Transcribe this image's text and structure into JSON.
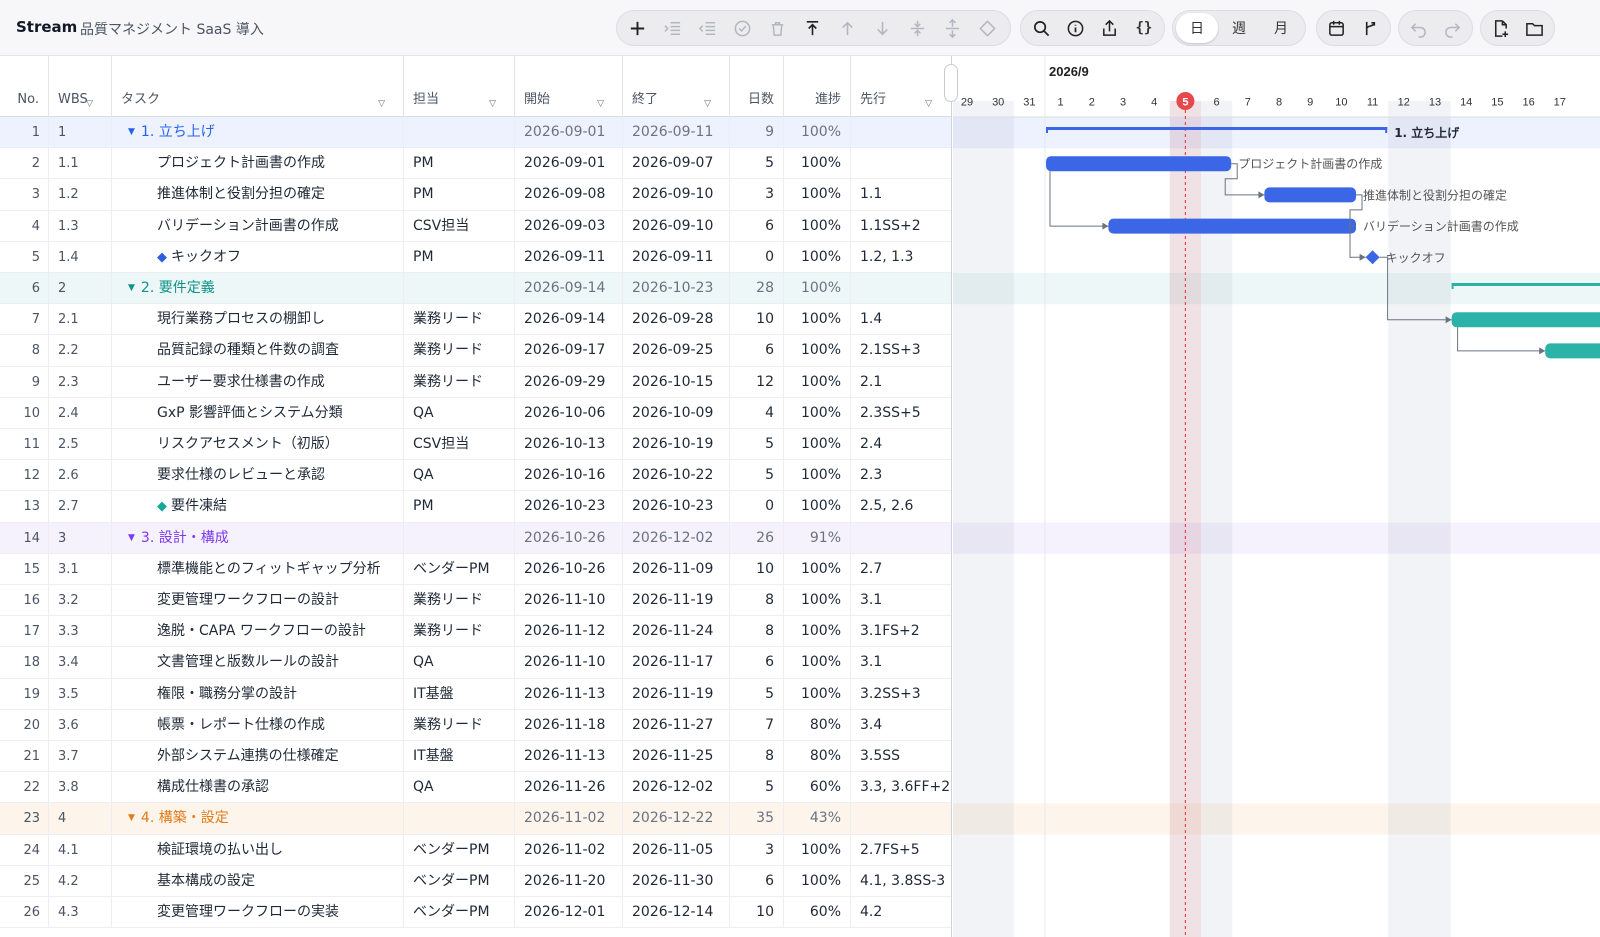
{
  "app": {
    "name": "Stream",
    "project": "品質マネジメント SaaS 導入"
  },
  "toolbar": {
    "views": [
      "日",
      "週",
      "月"
    ],
    "active_view": "日",
    "braces_label": "{}"
  },
  "columns": {
    "no": "No.",
    "wbs": "WBS",
    "task": "タスク",
    "owner": "担当",
    "start": "開始",
    "end": "終了",
    "days": "日数",
    "progress": "進捗",
    "pred": "先行"
  },
  "rows": [
    {
      "no": "1",
      "wbs": "1",
      "task": "1. 立ち上げ",
      "owner": "",
      "start": "2026-09-01",
      "end": "2026-09-11",
      "days": "9",
      "progress": "100%",
      "pred": "",
      "group": 1,
      "milestone": false
    },
    {
      "no": "2",
      "wbs": "1.1",
      "task": "プロジェクト計画書の作成",
      "owner": "PM",
      "start": "2026-09-01",
      "end": "2026-09-07",
      "days": "5",
      "progress": "100%",
      "pred": "",
      "group": 0,
      "milestone": false
    },
    {
      "no": "3",
      "wbs": "1.2",
      "task": "推進体制と役割分担の確定",
      "owner": "PM",
      "start": "2026-09-08",
      "end": "2026-09-10",
      "days": "3",
      "progress": "100%",
      "pred": "1.1",
      "group": 0,
      "milestone": false
    },
    {
      "no": "4",
      "wbs": "1.3",
      "task": "バリデーション計画書の作成",
      "owner": "CSV担当",
      "start": "2026-09-03",
      "end": "2026-09-10",
      "days": "6",
      "progress": "100%",
      "pred": "1.1SS+2",
      "group": 0,
      "milestone": false
    },
    {
      "no": "5",
      "wbs": "1.4",
      "task": "キックオフ",
      "owner": "PM",
      "start": "2026-09-11",
      "end": "2026-09-11",
      "days": "0",
      "progress": "100%",
      "pred": "1.2, 1.3",
      "group": 0,
      "milestone": true,
      "ms_color": "#2f5fe0"
    },
    {
      "no": "6",
      "wbs": "2",
      "task": "2. 要件定義",
      "owner": "",
      "start": "2026-09-14",
      "end": "2026-10-23",
      "days": "28",
      "progress": "100%",
      "pred": "",
      "group": 2,
      "milestone": false
    },
    {
      "no": "7",
      "wbs": "2.1",
      "task": "現行業務プロセスの棚卸し",
      "owner": "業務リード",
      "start": "2026-09-14",
      "end": "2026-09-28",
      "days": "10",
      "progress": "100%",
      "pred": "1.4",
      "group": 0,
      "milestone": false
    },
    {
      "no": "8",
      "wbs": "2.2",
      "task": "品質記録の種類と件数の調査",
      "owner": "業務リード",
      "start": "2026-09-17",
      "end": "2026-09-25",
      "days": "6",
      "progress": "100%",
      "pred": "2.1SS+3",
      "group": 0,
      "milestone": false
    },
    {
      "no": "9",
      "wbs": "2.3",
      "task": "ユーザー要求仕様書の作成",
      "owner": "業務リード",
      "start": "2026-09-29",
      "end": "2026-10-15",
      "days": "12",
      "progress": "100%",
      "pred": "2.1",
      "group": 0,
      "milestone": false
    },
    {
      "no": "10",
      "wbs": "2.4",
      "task": "GxP 影響評価とシステム分類",
      "owner": "QA",
      "start": "2026-10-06",
      "end": "2026-10-09",
      "days": "4",
      "progress": "100%",
      "pred": "2.3SS+5",
      "group": 0,
      "milestone": false
    },
    {
      "no": "11",
      "wbs": "2.5",
      "task": "リスクアセスメント（初版）",
      "owner": "CSV担当",
      "start": "2026-10-13",
      "end": "2026-10-19",
      "days": "5",
      "progress": "100%",
      "pred": "2.4",
      "group": 0,
      "milestone": false
    },
    {
      "no": "12",
      "wbs": "2.6",
      "task": "要求仕様のレビューと承認",
      "owner": "QA",
      "start": "2026-10-16",
      "end": "2026-10-22",
      "days": "5",
      "progress": "100%",
      "pred": "2.3",
      "group": 0,
      "milestone": false
    },
    {
      "no": "13",
      "wbs": "2.7",
      "task": "要件凍結",
      "owner": "PM",
      "start": "2026-10-23",
      "end": "2026-10-23",
      "days": "0",
      "progress": "100%",
      "pred": "2.5, 2.6",
      "group": 0,
      "milestone": true,
      "ms_color": "#17a89a"
    },
    {
      "no": "14",
      "wbs": "3",
      "task": "3. 設計・構成",
      "owner": "",
      "start": "2026-10-26",
      "end": "2026-12-02",
      "days": "26",
      "progress": "91%",
      "pred": "",
      "group": 3,
      "milestone": false
    },
    {
      "no": "15",
      "wbs": "3.1",
      "task": "標準機能とのフィットギャップ分析",
      "owner": "ベンダーPM",
      "start": "2026-10-26",
      "end": "2026-11-09",
      "days": "10",
      "progress": "100%",
      "pred": "2.7",
      "group": 0,
      "milestone": false
    },
    {
      "no": "16",
      "wbs": "3.2",
      "task": "変更管理ワークフローの設計",
      "owner": "業務リード",
      "start": "2026-11-10",
      "end": "2026-11-19",
      "days": "8",
      "progress": "100%",
      "pred": "3.1",
      "group": 0,
      "milestone": false
    },
    {
      "no": "17",
      "wbs": "3.3",
      "task": "逸脱・CAPA ワークフローの設計",
      "owner": "業務リード",
      "start": "2026-11-12",
      "end": "2026-11-24",
      "days": "8",
      "progress": "100%",
      "pred": "3.1FS+2",
      "group": 0,
      "milestone": false
    },
    {
      "no": "18",
      "wbs": "3.4",
      "task": "文書管理と版数ルールの設計",
      "owner": "QA",
      "start": "2026-11-10",
      "end": "2026-11-17",
      "days": "6",
      "progress": "100%",
      "pred": "3.1",
      "group": 0,
      "milestone": false
    },
    {
      "no": "19",
      "wbs": "3.5",
      "task": "権限・職務分掌の設計",
      "owner": "IT基盤",
      "start": "2026-11-13",
      "end": "2026-11-19",
      "days": "5",
      "progress": "100%",
      "pred": "3.2SS+3",
      "group": 0,
      "milestone": false
    },
    {
      "no": "20",
      "wbs": "3.6",
      "task": "帳票・レポート仕様の作成",
      "owner": "業務リード",
      "start": "2026-11-18",
      "end": "2026-11-27",
      "days": "7",
      "progress": "80%",
      "pred": "3.4",
      "group": 0,
      "milestone": false
    },
    {
      "no": "21",
      "wbs": "3.7",
      "task": "外部システム連携の仕様確定",
      "owner": "IT基盤",
      "start": "2026-11-13",
      "end": "2026-11-25",
      "days": "8",
      "progress": "80%",
      "pred": "3.5SS",
      "group": 0,
      "milestone": false
    },
    {
      "no": "22",
      "wbs": "3.8",
      "task": "構成仕様書の承認",
      "owner": "QA",
      "start": "2026-11-26",
      "end": "2026-12-02",
      "days": "5",
      "progress": "60%",
      "pred": "3.3, 3.6FF+2,",
      "group": 0,
      "milestone": false
    },
    {
      "no": "23",
      "wbs": "4",
      "task": "4. 構築・設定",
      "owner": "",
      "start": "2026-11-02",
      "end": "2026-12-22",
      "days": "35",
      "progress": "43%",
      "pred": "",
      "group": 4,
      "milestone": false
    },
    {
      "no": "24",
      "wbs": "4.1",
      "task": "検証環境の払い出し",
      "owner": "ベンダーPM",
      "start": "2026-11-02",
      "end": "2026-11-05",
      "days": "3",
      "progress": "100%",
      "pred": "2.7FS+5",
      "group": 0,
      "milestone": false
    },
    {
      "no": "25",
      "wbs": "4.2",
      "task": "基本構成の設定",
      "owner": "ベンダーPM",
      "start": "2026-11-20",
      "end": "2026-11-30",
      "days": "6",
      "progress": "100%",
      "pred": "4.1, 3.8SS-3",
      "group": 0,
      "milestone": false
    },
    {
      "no": "26",
      "wbs": "4.3",
      "task": "変更管理ワークフローの実装",
      "owner": "ベンダーPM",
      "start": "2026-12-01",
      "end": "2026-12-14",
      "days": "10",
      "progress": "60%",
      "pred": "4.2",
      "group": 0,
      "milestone": false
    }
  ],
  "gantt": {
    "month_label": "2026/9",
    "today_label": "5",
    "days": [
      "29",
      "30",
      "31",
      "1",
      "2",
      "3",
      "4",
      "5",
      "6",
      "7",
      "8",
      "9",
      "10",
      "11",
      "12",
      "13",
      "14",
      "15",
      "16",
      "17"
    ],
    "colors": {
      "blue": "#3b66e6",
      "teal": "#2bb3a8",
      "today": "#e5484d"
    },
    "bar_labels": [
      "1. 立ち上げ",
      "プロジェクト計画書の作成",
      "推進体制と役割分担の確定",
      "バリデーション計画書の作成",
      "キックオフ"
    ]
  }
}
